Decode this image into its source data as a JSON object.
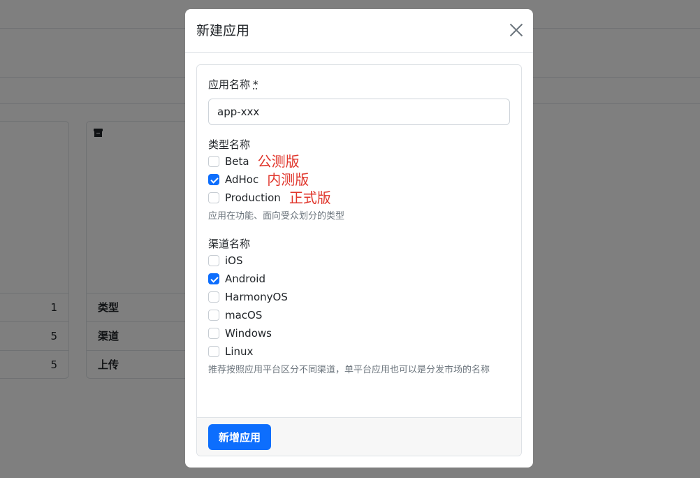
{
  "background": {
    "left_card_values": [
      "1",
      "5",
      "5"
    ],
    "right_card": {
      "icon": "archive-icon",
      "labels": [
        "类型",
        "渠道",
        "上传"
      ]
    }
  },
  "modal": {
    "title": "新建应用",
    "close_icon": "close-icon",
    "app_name": {
      "label": "应用名称",
      "required_mark": "*",
      "value": "app-xxx"
    },
    "type": {
      "label": "类型名称",
      "options": [
        {
          "label": "Beta",
          "checked": false,
          "annotation": "公测版"
        },
        {
          "label": "AdHoc",
          "checked": true,
          "annotation": "内测版"
        },
        {
          "label": "Production",
          "checked": false,
          "annotation": "正式版"
        }
      ],
      "help": "应用在功能、面向受众划分的类型"
    },
    "channel": {
      "label": "渠道名称",
      "options": [
        {
          "label": "iOS",
          "checked": false
        },
        {
          "label": "Android",
          "checked": true
        },
        {
          "label": "HarmonyOS",
          "checked": false
        },
        {
          "label": "macOS",
          "checked": false
        },
        {
          "label": "Windows",
          "checked": false
        },
        {
          "label": "Linux",
          "checked": false
        }
      ],
      "help": "推荐按照应用平台区分不同渠道，单平台应用也可以是分发市场的名称"
    },
    "submit_label": "新增应用"
  },
  "colors": {
    "primary": "#0d6efd",
    "annotation": "#e0362c",
    "backdrop": "rgba(0,0,0,0.5)"
  }
}
